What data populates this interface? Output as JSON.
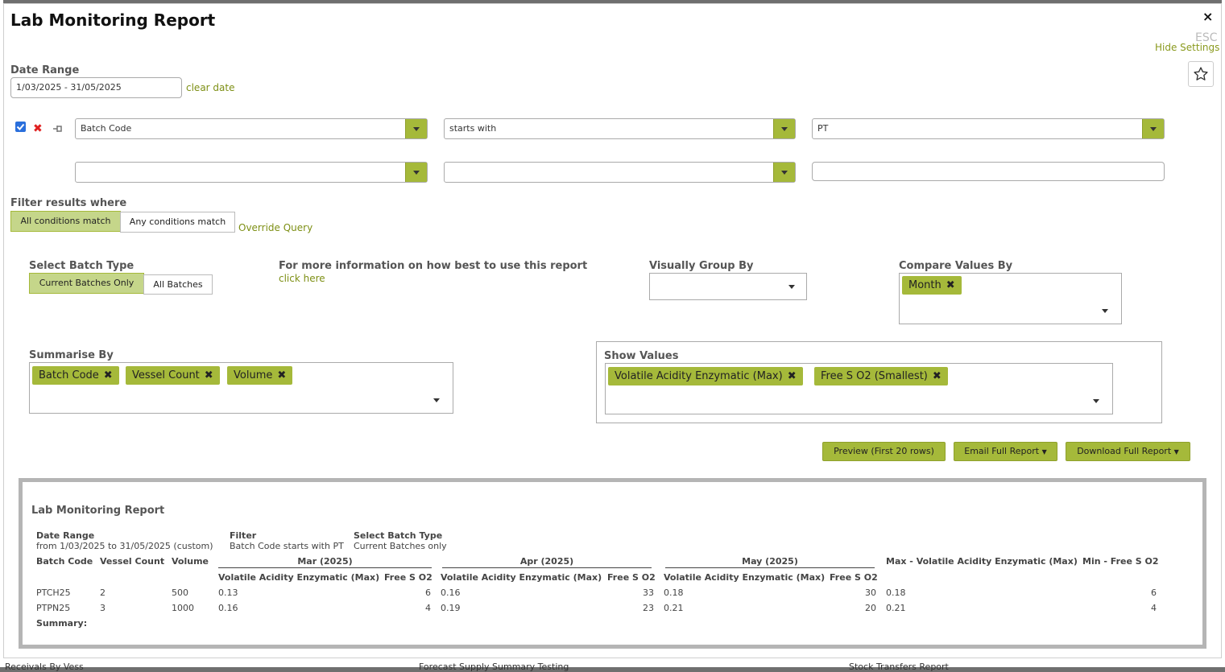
{
  "modal": {
    "title": "Lab Monitoring Report",
    "close_icon": "×",
    "esc_hint": "ESC",
    "hide_settings": "Hide Settings"
  },
  "date_range": {
    "label": "Date Range",
    "value": "1/03/2025 - 31/05/2025",
    "clear": "clear date"
  },
  "conditions": [
    {
      "field": "Batch Code",
      "operator": "starts with",
      "value": "PT",
      "checked": true
    },
    {
      "field": "",
      "operator": "",
      "value": ""
    }
  ],
  "filter": {
    "label": "Filter results where",
    "all": "All conditions match",
    "any": "Any conditions match",
    "override": "Override Query"
  },
  "batch_type": {
    "label": "Select Batch Type",
    "current": "Current Batches Only",
    "all": "All Batches"
  },
  "info": {
    "label": "For more information on how best to use this report",
    "link": "click here"
  },
  "group_by": {
    "label": "Visually Group By",
    "value": ""
  },
  "compare_by": {
    "label": "Compare Values By",
    "tags": [
      "Month"
    ]
  },
  "summarise_by": {
    "label": "Summarise By",
    "tags": [
      "Batch Code",
      "Vessel Count",
      "Volume"
    ]
  },
  "show_values": {
    "label": "Show Values",
    "tags": [
      "Volatile Acidity Enzymatic (Max)",
      "Free S O2 (Smallest)"
    ]
  },
  "actions": {
    "preview": "Preview (First 20 rows)",
    "email": "Email Full Report",
    "download": "Download Full Report"
  },
  "report": {
    "title": "Lab Monitoring Report",
    "meta": [
      {
        "label": "Date Range",
        "value": "from 1/03/2025 to 31/05/2025 (custom)"
      },
      {
        "label": "Filter",
        "value": "Batch Code starts with PT"
      },
      {
        "label": "Select Batch Type",
        "value": "Current Batches only"
      }
    ],
    "columns": [
      "Batch Code",
      "Vessel Count",
      "Volume"
    ],
    "groups": [
      "Mar (2025)",
      "Apr (2025)",
      "May (2025)"
    ],
    "sub_columns": [
      "Volatile Acidity Enzymatic (Max)",
      "Free S O2"
    ],
    "totals_columns": [
      "Max - Volatile Acidity Enzymatic (Max)",
      "Min - Free S O2"
    ],
    "rows": [
      {
        "batch": "PTCH25",
        "vessels": "2",
        "volume": "500",
        "values": [
          "0.13",
          "6",
          "0.16",
          "33",
          "0.18",
          "30"
        ],
        "max": "0.18",
        "min": "6"
      },
      {
        "batch": "PTPN25",
        "vessels": "3",
        "volume": "1000",
        "values": [
          "0.16",
          "4",
          "0.19",
          "23",
          "0.21",
          "20"
        ],
        "max": "0.21",
        "min": "4"
      }
    ],
    "summary_label": "Summary:"
  },
  "background": {
    "left": "Receivals By Vess",
    "middle": "Forecast Supply Summary Testing",
    "right": "Stock Transfers Report"
  },
  "colors": {
    "accent": "#a5b93a",
    "link": "#7d8f14",
    "active": "#c5d68a"
  }
}
